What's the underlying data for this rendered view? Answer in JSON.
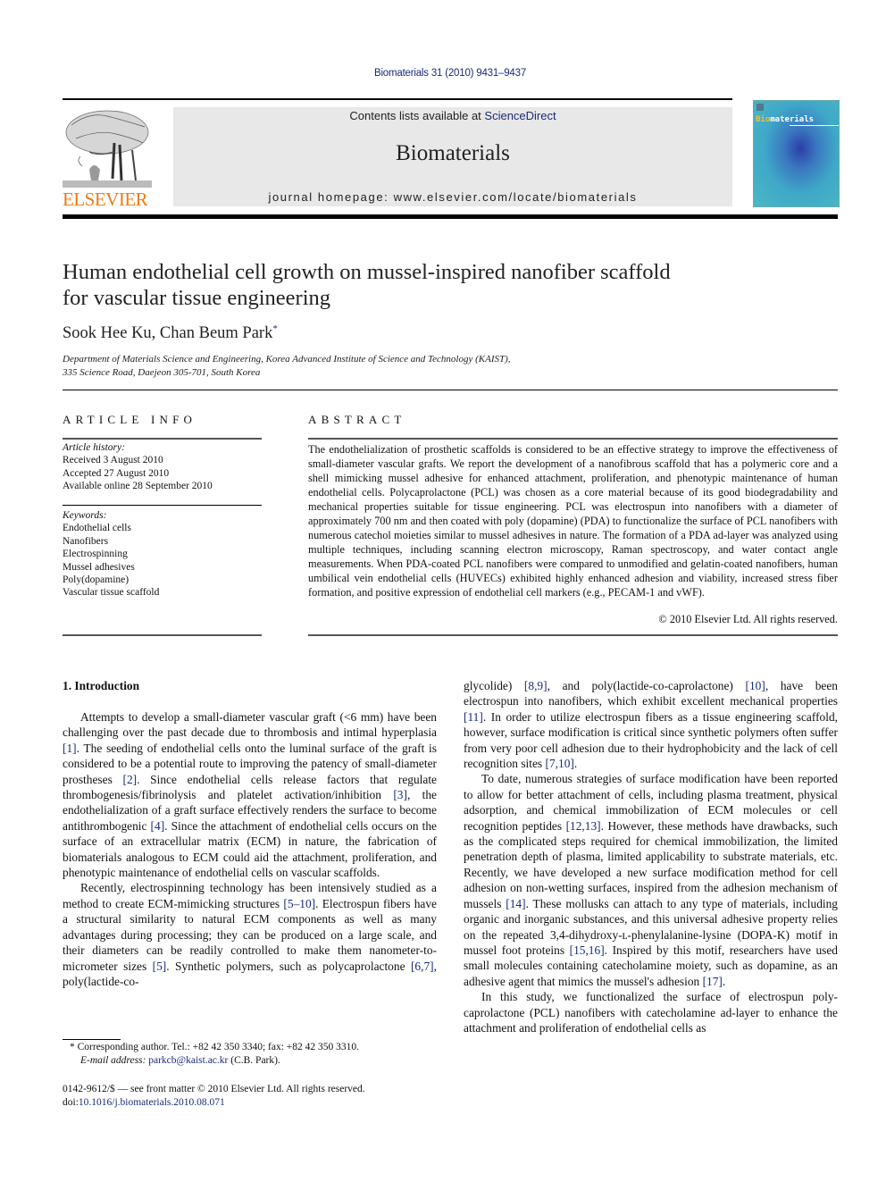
{
  "header": {
    "journal_ref": "Biomaterials 31 (2010) 9431–9437",
    "contents_prefix": "Contents lists available at ",
    "contents_link": "ScienceDirect",
    "journal_name": "Biomaterials",
    "homepage": "journal homepage: www.elsevier.com/locate/biomaterials",
    "publisher_logo_text": "ELSEVIER",
    "cover_title_accent": "Bio",
    "cover_title_rest": "materials",
    "colors": {
      "elsevier_orange": "#f07a10",
      "link_blue": "#1a2a7a",
      "banner_gray": "#e8e8e8"
    }
  },
  "article": {
    "title_line1": "Human endothelial cell growth on mussel-inspired nanofiber scaffold",
    "title_line2": "for vascular tissue engineering",
    "authors": "Sook Hee Ku, Chan Beum Park",
    "author_mark": "*",
    "affiliation_line1": "Department of Materials Science and Engineering, Korea Advanced Institute of Science and Technology (KAIST),",
    "affiliation_line2": "335 Science Road, Daejeon 305-701, South Korea"
  },
  "article_info": {
    "heading": "ARTICLE INFO",
    "history_label": "Article history:",
    "history": [
      "Received 3 August 2010",
      "Accepted 27 August 2010",
      "Available online 28 September 2010"
    ],
    "keywords_label": "Keywords:",
    "keywords": [
      "Endothelial cells",
      "Nanofibers",
      "Electrospinning",
      "Mussel adhesives",
      "Poly(dopamine)",
      "Vascular tissue scaffold"
    ]
  },
  "abstract": {
    "heading": "ABSTRACT",
    "text": "The endothelialization of prosthetic scaffolds is considered to be an effective strategy to improve the effectiveness of small-diameter vascular grafts. We report the development of a nanofibrous scaffold that has a polymeric core and a shell mimicking mussel adhesive for enhanced attachment, proliferation, and phenotypic maintenance of human endothelial cells. Polycaprolactone (PCL) was chosen as a core material because of its good biodegradability and mechanical properties suitable for tissue engineering. PCL was electrospun into nanofibers with a diameter of approximately 700 nm and then coated with poly (dopamine) (PDA) to functionalize the surface of PCL nanofibers with numerous catechol moieties similar to mussel adhesives in nature. The formation of a PDA ad-layer was analyzed using multiple techniques, including scanning electron microscopy, Raman spectroscopy, and water contact angle measurements. When PDA-coated PCL nanofibers were compared to unmodified and gelatin-coated nanofibers, human umbilical vein endothelial cells (HUVECs) exhibited highly enhanced adhesion and viability, increased stress fiber formation, and positive expression of endothelial cell markers (e.g., PECAM-1 and vWF).",
    "copyright": "© 2010 Elsevier Ltd. All rights reserved."
  },
  "introduction": {
    "heading": "1.  Introduction",
    "col1": [
      [
        {
          "t": "Attempts to develop a small-diameter vascular graft (<6 mm) have been challenging over the past decade due to thrombosis and intimal hyperplasia "
        },
        {
          "t": "[1]",
          "ref": true
        },
        {
          "t": ". The seeding of endothelial cells onto the luminal surface of the graft is considered to be a potential route to improving the patency of small-diameter prostheses "
        },
        {
          "t": "[2]",
          "ref": true
        },
        {
          "t": ". Since endothelial cells release factors that regulate thrombogenesis/fibri­nolysis and platelet activation/inhibition "
        },
        {
          "t": "[3]",
          "ref": true
        },
        {
          "t": ", the endothelialization of a graft surface effectively renders the surface to become anti­thrombogenic "
        },
        {
          "t": "[4]",
          "ref": true
        },
        {
          "t": ". Since the attachment of endothelial cells occurs on the surface of an extracellular matrix (ECM) in nature, the fabri­cation of biomaterials analogous to ECM could aid the attachment, proliferation, and phenotypic maintenance of endothelial cells on vascular scaffolds."
        }
      ],
      [
        {
          "t": "Recently, electrospinning technology has been intensively studied as a method to create ECM-mimicking structures "
        },
        {
          "t": "[5–10]",
          "ref": true
        },
        {
          "t": ". Electrospun fibers have a structural similarity to natural ECM components as well as many advantages during processing; they can be produced on a large scale, and their diameters can be readily controlled to make them nanometer-to-micrometer sizes "
        },
        {
          "t": "[5]",
          "ref": true
        },
        {
          "t": ". Synthetic polymers, such as polycaprolactone "
        },
        {
          "t": "[6,7]",
          "ref": true
        },
        {
          "t": ", poly(lactide-co-"
        }
      ]
    ],
    "col2": [
      [
        {
          "t": "glycolide) "
        },
        {
          "t": "[8,9]",
          "ref": true
        },
        {
          "t": ", and poly(lactide-co-caprolactone) "
        },
        {
          "t": "[10]",
          "ref": true
        },
        {
          "t": ", have been electrospun into nanofibers, which exhibit excellent mechanical properties "
        },
        {
          "t": "[11]",
          "ref": true
        },
        {
          "t": ". In order to utilize electrospun fibers as a tissue engineering scaffold, however, surface modification is critical since synthetic polymers often suffer from very poor cell adhesion due to their hydrophobicity and the lack of cell recognition sites "
        },
        {
          "t": "[7,10]",
          "ref": true
        },
        {
          "t": "."
        }
      ],
      [
        {
          "t": "To date, numerous strategies of surface modification have been reported to allow for better attachment of cells, including plasma treatment, physical adsorption, and chemical immobilization of ECM molecules or cell recognition peptides "
        },
        {
          "t": "[12,13]",
          "ref": true
        },
        {
          "t": ". However, these methods have drawbacks, such as the complicated steps required for chemical immobilization, the limited penetration depth of plasma, limited applicability to substrate materials, etc. Recently, we have developed a new surface modification method for cell adhesion on non-wetting surfaces, inspired from the adhesion mechanism of mussels "
        },
        {
          "t": "[14]",
          "ref": true
        },
        {
          "t": ". These mollusks can attach to any type of materials, including organic and inorganic substances, and this universal adhesive property relies on the repeated 3,4-dihydroxy-ʟ-phenylalanine-lysine (DOPA-K) motif in mussel foot proteins "
        },
        {
          "t": "[15,16]",
          "ref": true
        },
        {
          "t": ". Inspired by this motif, researchers have used small mole­cules containing catecholamine moiety, such as dopamine, as an adhesive agent that mimics the mussel's adhesion "
        },
        {
          "t": "[17]",
          "ref": true
        },
        {
          "t": "."
        }
      ],
      [
        {
          "t": "In this study, we functionalized the surface of electrospun poly­caprolactone (PCL) nanofibers with catecholamine ad-layer to enhance the attachment and proliferation of endothelial cells as"
        }
      ]
    ]
  },
  "footnote": {
    "mark": "*",
    "corresponding": "Corresponding author. Tel.: +82 42 350 3340; fax: +82 42 350 3310.",
    "email_label": "E-mail address: ",
    "email": "parkcb@kaist.ac.kr",
    "email_suffix": " (C.B. Park).",
    "front_matter": "0142-9612/$ — see front matter © 2010 Elsevier Ltd. All rights reserved.",
    "doi_label": "doi:",
    "doi": "10.1016/j.biomaterials.2010.08.071"
  }
}
